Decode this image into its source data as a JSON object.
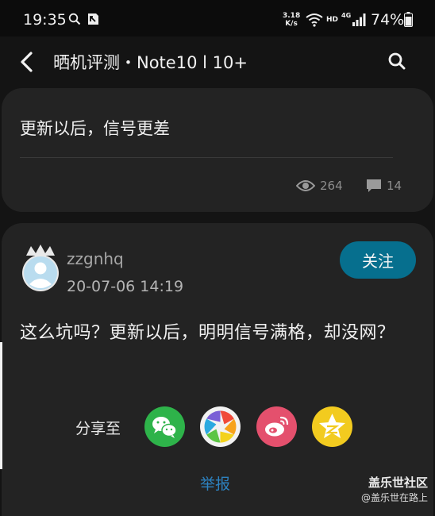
{
  "status_bar": {
    "time": "19:35",
    "net_speed_value": "3.18",
    "net_speed_unit": "K/s",
    "hd": "HD",
    "network": "4G",
    "battery": "74%",
    "icons": [
      "search-icon",
      "app-notification-icon",
      "wifi-icon",
      "signal-icon",
      "battery-icon"
    ]
  },
  "nav": {
    "title": "晒机评测・Note10 l 10+",
    "back_icon": "chevron-left-icon",
    "search_icon": "search-icon"
  },
  "post": {
    "title": "更新以后，信号更差",
    "views": "264",
    "comments": "14"
  },
  "reply": {
    "username": "zzgnhq",
    "time": "20-07-06 14:19",
    "follow_label": "关注",
    "text": "这么坑吗？更新以后，明明信号满格，却没网？"
  },
  "share": {
    "label": "分享至",
    "targets": [
      "wechat",
      "moments",
      "weibo",
      "qzone"
    ]
  },
  "report_label": "举报",
  "watermark": {
    "title": "盖乐世社区",
    "subtitle": "@盖乐世在路上"
  },
  "colors": {
    "background": "#141414",
    "card": "#232323",
    "accent": "#066f8e",
    "link": "#2d82c0"
  }
}
